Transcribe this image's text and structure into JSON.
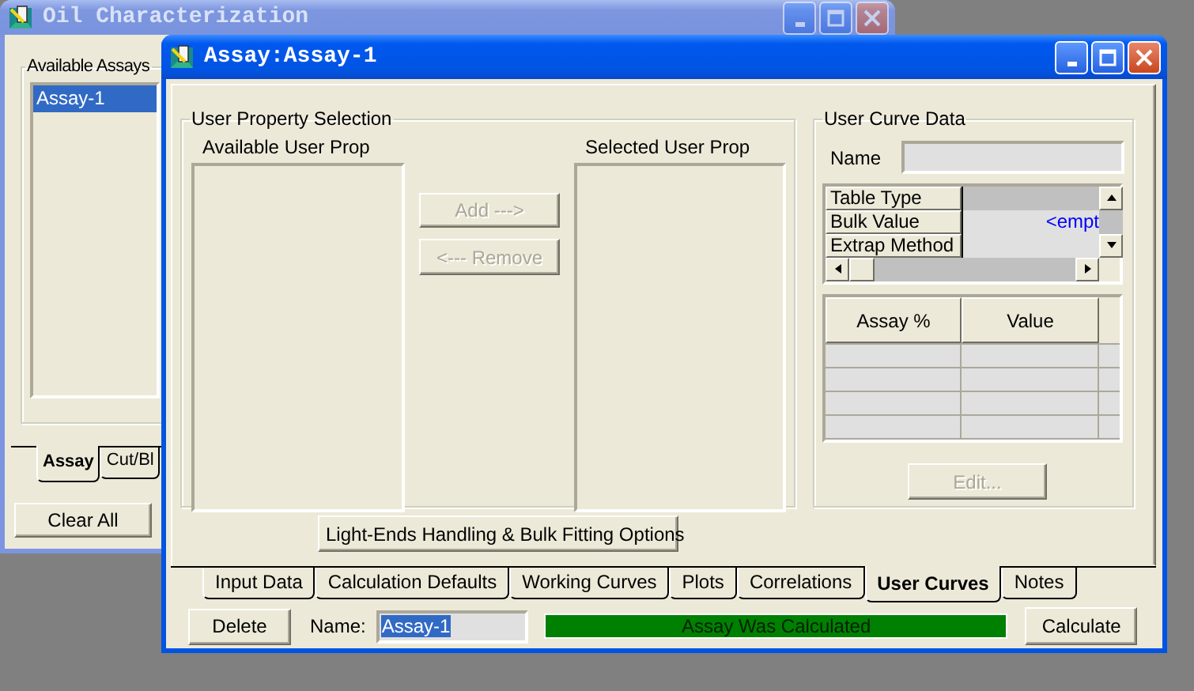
{
  "back_window": {
    "title": "Oil Characterization",
    "group_label": "Available Assays",
    "assays": [
      {
        "label": "Assay-1",
        "selected": true
      }
    ],
    "tabs": [
      {
        "label": "Assay",
        "selected": true
      },
      {
        "label": "Cut/Bl",
        "selected": false
      }
    ],
    "clear_button": "Clear All"
  },
  "window": {
    "title": "Assay:Assay-1"
  },
  "user_property_selection": {
    "title": "User Property Selection",
    "available_label": "Available User Prop",
    "selected_label": "Selected User Prop",
    "add_button": {
      "label": "Add --->",
      "disabled": true
    },
    "remove_button": {
      "label": "<--- Remove",
      "disabled": true
    }
  },
  "user_curve_data": {
    "title": "User Curve Data",
    "name_label": "Name",
    "properties": [
      {
        "label": "Table Type",
        "selected": true
      },
      {
        "label": "Bulk Value",
        "value": "<empt",
        "selected": false
      },
      {
        "label": "Extrap Method",
        "selected": false
      }
    ],
    "columns": [
      "Assay %",
      "Value"
    ],
    "edit_button": {
      "label": "Edit...",
      "disabled": true
    }
  },
  "options_button": "Light-Ends Handling & Bulk Fitting Options",
  "tabs": [
    {
      "label": "Input Data",
      "selected": false
    },
    {
      "label": "Calculation Defaults",
      "selected": false
    },
    {
      "label": "Working Curves",
      "selected": false
    },
    {
      "label": "Plots",
      "selected": false
    },
    {
      "label": "Correlations",
      "selected": false
    },
    {
      "label": "User Curves",
      "selected": true
    },
    {
      "label": "Notes",
      "selected": false
    }
  ],
  "footer": {
    "delete_button": "Delete",
    "name_label": "Name:",
    "name_field": {
      "value": "Assay-1",
      "selected": true
    },
    "status": "Assay Was Calculated",
    "calculate_button": "Calculate"
  }
}
